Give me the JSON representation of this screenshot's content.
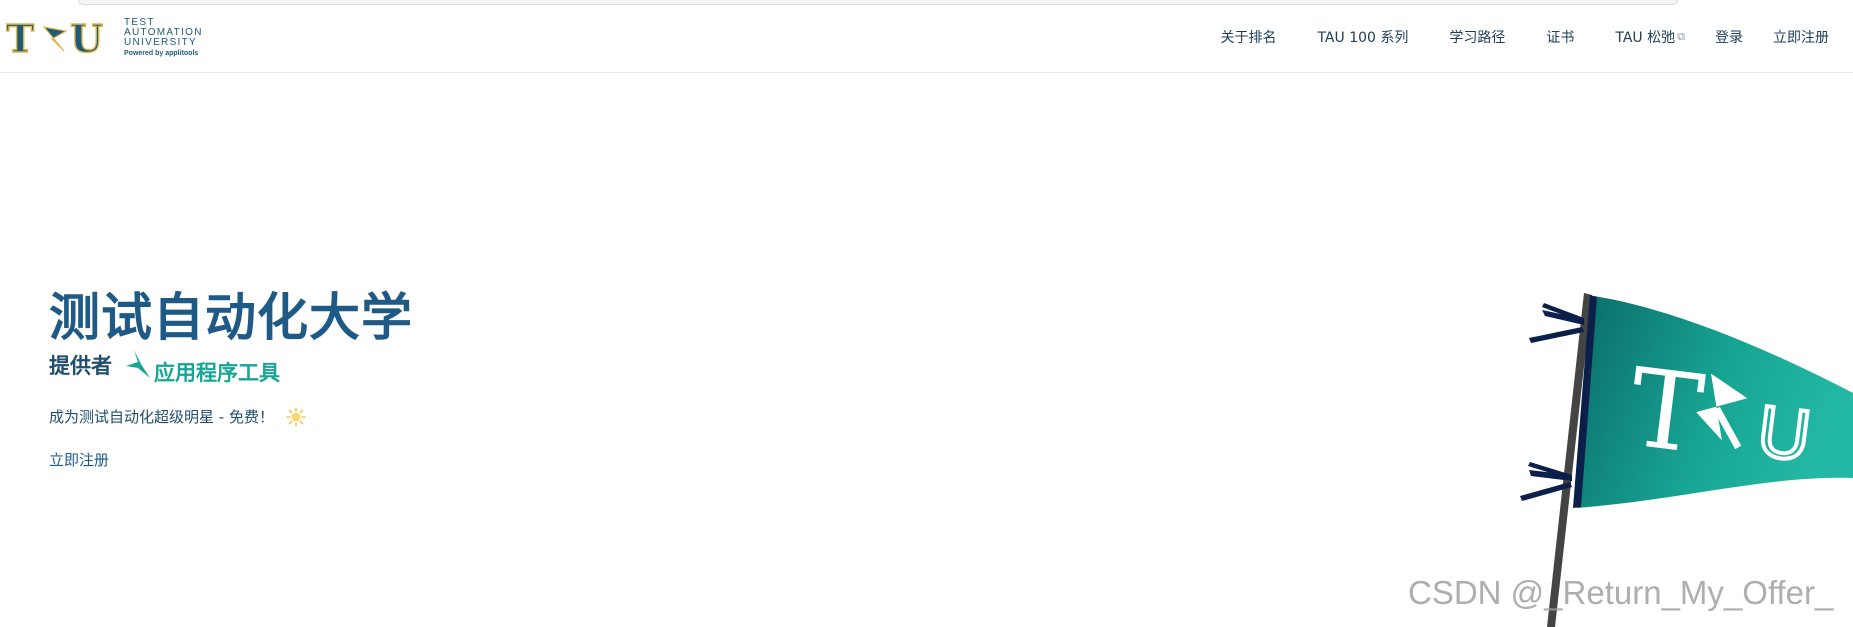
{
  "header": {
    "logo": {
      "mark": "TAU",
      "line1": "TEST",
      "line2": "AUTOMATION",
      "line3": "UNIVERSITY",
      "powered": "Powered by applitools"
    },
    "nav": [
      {
        "label": "关于排名"
      },
      {
        "label": "TAU 100 系列"
      },
      {
        "label": "学习路径"
      },
      {
        "label": "证书"
      },
      {
        "label": "TAU 松弛",
        "external": true
      },
      {
        "label": "登录"
      },
      {
        "label": "立即注册"
      }
    ]
  },
  "hero": {
    "title": "测试自动化大学",
    "byline_label": "提供者",
    "brand_name": "应用程序工具",
    "tagline": "成为测试自动化超级明星 - 免费！",
    "signup_link": "立即注册",
    "flag_text": "TAU"
  },
  "watermark": "CSDN @_Return_My_Offer_",
  "colors": {
    "primary": "#1f5a87",
    "teal": "#18a596",
    "flag_dark": "#0d6e6a",
    "flag_light": "#1db09f",
    "navy": "#0b1f4a"
  },
  "icons": {
    "external": "external-link-icon",
    "sun": "sun-icon",
    "brand": "applitools-star-icon"
  }
}
